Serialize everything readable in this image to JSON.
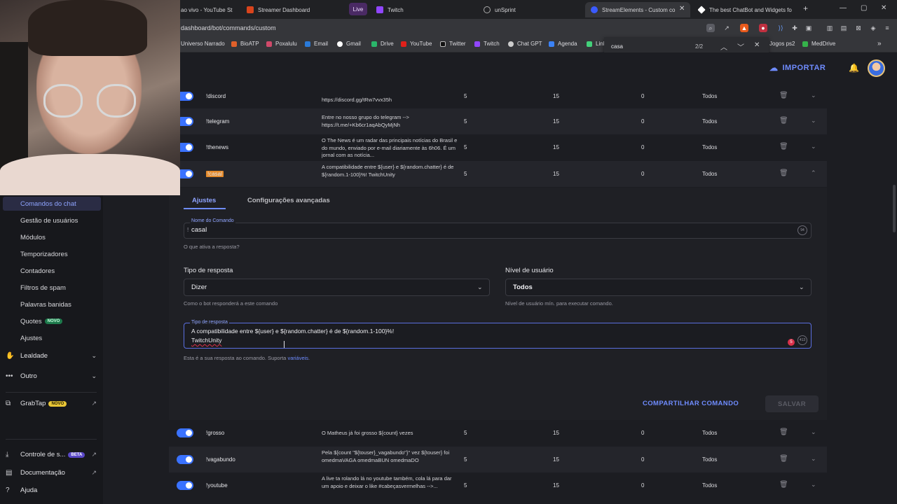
{
  "browser": {
    "tabs": [
      {
        "label": "ao vivo - YouTube St",
        "active": false
      },
      {
        "label": "Streamer Dashboard",
        "active": false
      },
      {
        "label": "Live",
        "active": false
      },
      {
        "label": "Twitch",
        "active": false
      },
      {
        "label": "unSprint",
        "active": false
      },
      {
        "label": "StreamElements - Custom co",
        "active": true
      },
      {
        "label": "The best ChatBot and Widgets fo",
        "active": false
      }
    ],
    "new_tab": "+",
    "url": "dashboard/bot/commands/custom",
    "extension_badges": {
      "shield": "5",
      "ext": "1"
    },
    "bookmarks": [
      "Universo Narrado",
      "BioATP",
      "Poxalulu",
      "Email",
      "Gmail",
      "Drive",
      "YouTube",
      "Twitter",
      "Twitch",
      "Chat GPT",
      "Agenda",
      "Link",
      "Jogos ps2",
      "MedDrive"
    ],
    "find": {
      "query": "casa",
      "count": "2/2"
    }
  },
  "header": {
    "import_label": "IMPORTAR"
  },
  "sidebar": {
    "items": [
      {
        "label": "Comandos do chat",
        "active": true
      },
      {
        "label": "Gestão de usuários"
      },
      {
        "label": "Módulos"
      },
      {
        "label": "Temporizadores"
      },
      {
        "label": "Contadores"
      },
      {
        "label": "Filtros de spam"
      },
      {
        "label": "Palavras banidas"
      },
      {
        "label": "Quotes",
        "badge": "NOVO"
      },
      {
        "label": "Ajustes"
      }
    ],
    "groups": [
      {
        "label": "Lealdade"
      },
      {
        "label": "Outro"
      }
    ],
    "grabtap": {
      "label": "GrabTap",
      "badge": "NOVO"
    },
    "footer": [
      {
        "label": "Controle de s...",
        "badge": "BETA"
      },
      {
        "label": "Documentação"
      },
      {
        "label": "Ajuda"
      }
    ]
  },
  "commands_top": [
    {
      "name": "!discord",
      "response": "https://discord.gg/tRw7vvx35h",
      "cooldown": "5",
      "user_cd": "15",
      "cost": "0",
      "level": "Todos"
    },
    {
      "name": "!telegram",
      "response": "Entre no nosso grupo do telegram --> https://t.me/+Kb6cr1aqAbQyMjNh",
      "cooldown": "5",
      "user_cd": "15",
      "cost": "0",
      "level": "Todos"
    },
    {
      "name": "!thenews",
      "response": "O The News é um radar das principais notícias do Brasil e do mundo, enviado por e-mail diariamente às 6h06. É um jornal com as notícia...",
      "cooldown": "5",
      "user_cd": "15",
      "cost": "0",
      "level": "Todos"
    },
    {
      "name": "!casal",
      "response": "A compatibilidade entre ${user} e ${random.chatter} é de ${random.1-100}%! TwitchUnity",
      "cooldown": "5",
      "user_cd": "15",
      "cost": "0",
      "level": "Todos"
    }
  ],
  "editor": {
    "tabs": [
      "Ajustes",
      "Configurações avançadas"
    ],
    "name_label": "Nome do Comando",
    "name_prefix": "!",
    "name_value": "casal",
    "name_hint": "O que ativa a resposta?",
    "name_counter": "94",
    "type_title": "Tipo de resposta",
    "type_value": "Dizer",
    "type_hint": "Como o bot responderá a este comando",
    "level_title": "Nível de usuário",
    "level_value": "Todos",
    "level_hint": "Nível de usuário mín. para executar comando.",
    "response_label": "Tipo de resposta",
    "response_line1": "A compatibilidade entre ${user} e ${random.chatter} é de ${random.1-100}%!",
    "response_line2": "TwitchUnity",
    "response_counter": "413",
    "grammar_count": "5",
    "response_hint": "Esta é a sua resposta ao comando. Suporta",
    "response_hint_link": "variáveis",
    "response_hint_end": ".",
    "share_label": "COMPARTILHAR COMANDO",
    "save_label": "SALVAR"
  },
  "commands_bottom": [
    {
      "name": "!grosso",
      "response": "O Matheus já foi grosso ${count} vezes",
      "cooldown": "5",
      "user_cd": "15",
      "cost": "0",
      "level": "Todos"
    },
    {
      "name": "!vagabundo",
      "response": "Pela ${count \"${touser}_vagabundo\"}° vez ${touser} foi omedmaVAGA omedmaBUN omedmaDO",
      "cooldown": "5",
      "user_cd": "15",
      "cost": "0",
      "level": "Todos"
    },
    {
      "name": "!youtube",
      "response": "A live ta rolando lá no youtube também, cola lá para dar um apoio e deixar o like #cabeçasvermelhas -->...",
      "cooldown": "5",
      "user_cd": "15",
      "cost": "0",
      "level": "Todos"
    }
  ],
  "colors": {
    "accent": "#6f8cff",
    "toggle": "#3a72ff",
    "highlight": "#e58a2a",
    "bg": "#1c1d22"
  }
}
